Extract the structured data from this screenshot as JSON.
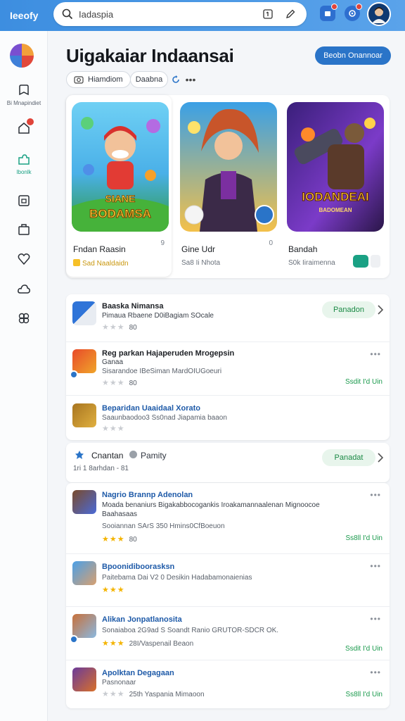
{
  "app": {
    "brand": "Ieeofy"
  },
  "search": {
    "query": "Iadaspia"
  },
  "topbar": {
    "icons": [
      "message-icon",
      "edit-icon",
      "notification-icon",
      "settings-icon"
    ],
    "accent": "#4a9ae6"
  },
  "sidebar": {
    "items": [
      {
        "icon": "tag-icon",
        "label": "Bi Mnapindiet"
      },
      {
        "icon": "home-icon",
        "label": ""
      },
      {
        "icon": "puzzle-icon",
        "label": "Ibonlk"
      },
      {
        "icon": "tablet-icon",
        "label": ""
      },
      {
        "icon": "bag-icon",
        "label": ""
      },
      {
        "icon": "heart-icon",
        "label": ""
      },
      {
        "icon": "cloud-icon",
        "label": ""
      },
      {
        "icon": "gamepad-icon",
        "label": ""
      }
    ]
  },
  "header": {
    "title": "Uigakaiar Indaansai",
    "primary_button": "Beobn Onannoar",
    "chips": [
      {
        "label": "Hiamdiom"
      },
      {
        "label": "Daabna"
      }
    ]
  },
  "featured": [
    {
      "title": "Fndan Raasin",
      "number": "9",
      "meta": "Sad Naaldaidn",
      "art_text": "BODAMSA",
      "art_top": "SIANE"
    },
    {
      "title": "Gine Udr",
      "number": "0",
      "meta": "Sa8 Ii Nhota",
      "art_text": "",
      "art_top": ""
    },
    {
      "title": "Bandah",
      "number": "",
      "meta": "S0k Iiraimenna",
      "art_text": "IODANDEAI",
      "art_top": "BADOMEAN"
    }
  ],
  "list1": [
    {
      "title": "Baaska Nimansa",
      "line1": "Pimaua Rbaene D0iBagiam SOcale",
      "rating": 3,
      "rating_text": "80",
      "button": "Panadon"
    },
    {
      "title": "Reg parkan Hajaperuden Mrogepsin",
      "line1": "Ganaa",
      "line2": "Sisarandoe IBeSiman MardOIUGoeuri",
      "rating": 3,
      "rating_text": "80",
      "link": "Ssdit I'd Uin"
    },
    {
      "title": "Beparidan Uaaidaal Xorato",
      "line1": "Saaunbaodoo3 Ss0nad Jiapamia baaon",
      "rating": 3,
      "rating_text": ""
    }
  ],
  "section": {
    "title": "Cnantan",
    "sub_label": "Pamity",
    "meta": "1ri 1 8arhdan - 81",
    "button": "Panadat"
  },
  "list2": [
    {
      "title": "Nagrio Brannp Adenolan",
      "line1": "Moada benaniurs Bigakabbocogankis Iroakamannaalenan Mignoocoe",
      "line2": "Baahasaas",
      "line3": "Sooiannan SArS 350 Hmins0CfBoeuon",
      "rating": 3,
      "rating_text": "80",
      "link": "Ss8ll I'd Uin"
    },
    {
      "title": "Bpoonidiboorasksn",
      "line1": "Paitebama Dai V2 0 Desikin Hadabamonaienias",
      "rating": 3,
      "rating_text": ""
    },
    {
      "title": "Alikan Jonpatlanosita",
      "line1": "Sonaiaboa 2G9ad S Soandt Ranio GRUTOR-SDCR OK.",
      "rating": 3,
      "rating_text": "28I/Vaspenail Beaon",
      "link": "Ssdit I'd Uin"
    },
    {
      "title": "Apolktan Degagaan",
      "line1": "Pasnonaar",
      "rating": 3,
      "rating_text": "25th Yaspania Mimaoon",
      "link": "Ss8ll I'd Uin"
    }
  ]
}
